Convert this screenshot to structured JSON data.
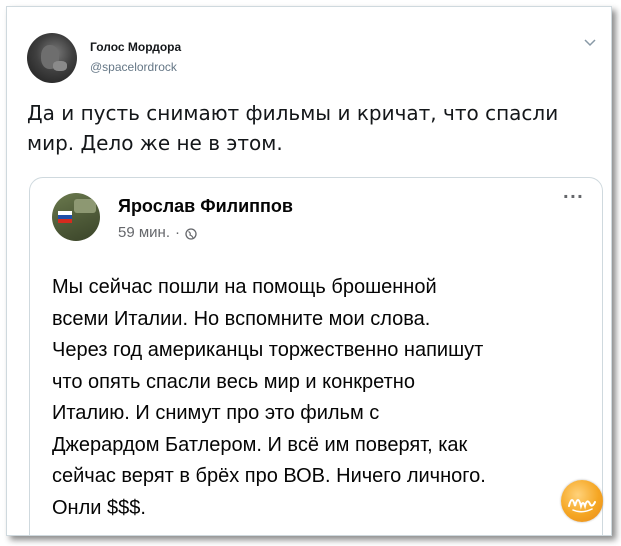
{
  "tweet": {
    "author_name": "Голос Мордора",
    "author_handle": "@spacelordrock",
    "text": "Да и пусть снимают фильмы и кричат, что спасли мир. Дело же не в этом.",
    "icons": {
      "avatar": "user-avatar",
      "menu": "chevron-down-icon"
    }
  },
  "embedded_post": {
    "author_name": "Ярослав Филиппов",
    "time": "59 мин.",
    "separator": "·",
    "more": "···",
    "icons": {
      "avatar": "user-avatar",
      "privacy": "globe-icon"
    },
    "text_lines": [
      "Мы сейчас пошли на помощь брошенной",
      "всеми Италии. Но вспомните мои слова.",
      "Через год американцы торжественно напишут",
      "что опять спасли весь мир и конкретно",
      "Италию. И снимут про это фильм с",
      "Джерардом Батлером. И всё им поверят, как",
      "сейчас верят в брёх про ВОВ. Ничего личного.",
      "Онли $$$."
    ]
  },
  "watermark": {
    "icon": "nyka-logo",
    "color": "#f5a623"
  }
}
